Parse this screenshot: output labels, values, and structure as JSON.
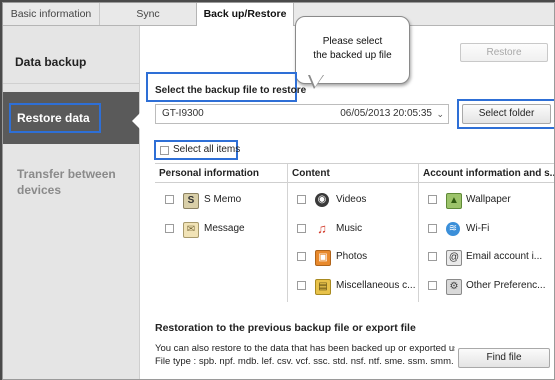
{
  "tabs": [
    {
      "label": "Basic information"
    },
    {
      "label": "Sync"
    },
    {
      "label": "Back up/Restore"
    }
  ],
  "sidebar": {
    "items": [
      {
        "label": "Data backup"
      },
      {
        "label": "Restore data"
      },
      {
        "label_line1": "Transfer between",
        "label_line2": "devices"
      }
    ]
  },
  "callout": {
    "line1": "Please select",
    "line2": "the backed up file"
  },
  "restore_button": "Restore",
  "select_file_label": "Select the backup file to restore",
  "file_select": {
    "device": "GT-I9300",
    "date": "06/05/2013 20:05:35"
  },
  "select_folder_button": "Select folder",
  "select_all_label": "Select all items",
  "table": {
    "headers": [
      "Personal information",
      "Content",
      "Account information and s..."
    ],
    "personal": [
      {
        "label": "S Memo",
        "icon": "smemo-icon"
      },
      {
        "label": "Message",
        "icon": "message-icon"
      }
    ],
    "content": [
      {
        "label": "Videos",
        "icon": "video-icon"
      },
      {
        "label": "Music",
        "icon": "music-icon"
      },
      {
        "label": "Photos",
        "icon": "photo-icon"
      },
      {
        "label": "Miscellaneous c...",
        "icon": "misc-icon"
      }
    ],
    "account": [
      {
        "label": "Wallpaper",
        "icon": "wallpaper-icon"
      },
      {
        "label": "Wi-Fi",
        "icon": "wifi-icon"
      },
      {
        "label": "Email account i...",
        "icon": "email-icon"
      },
      {
        "label": "Other Preferenc...",
        "icon": "preferences-icon"
      }
    ]
  },
  "restoration": {
    "title": "Restoration to the previous backup file or export file",
    "line1": "You can also restore to the data that has been backed up or exported using",
    "line2": "File type : spb. npf. mdb. lef. csv. vcf. ssc. std. nsf. ntf. sme. ssm. smm. nmf. s"
  },
  "find_file_button": "Find file",
  "colors": {
    "highlight": "#2e6fd6",
    "sidebar_active": "#5a5a5a",
    "sidebar_bg": "#e5e5e5"
  }
}
